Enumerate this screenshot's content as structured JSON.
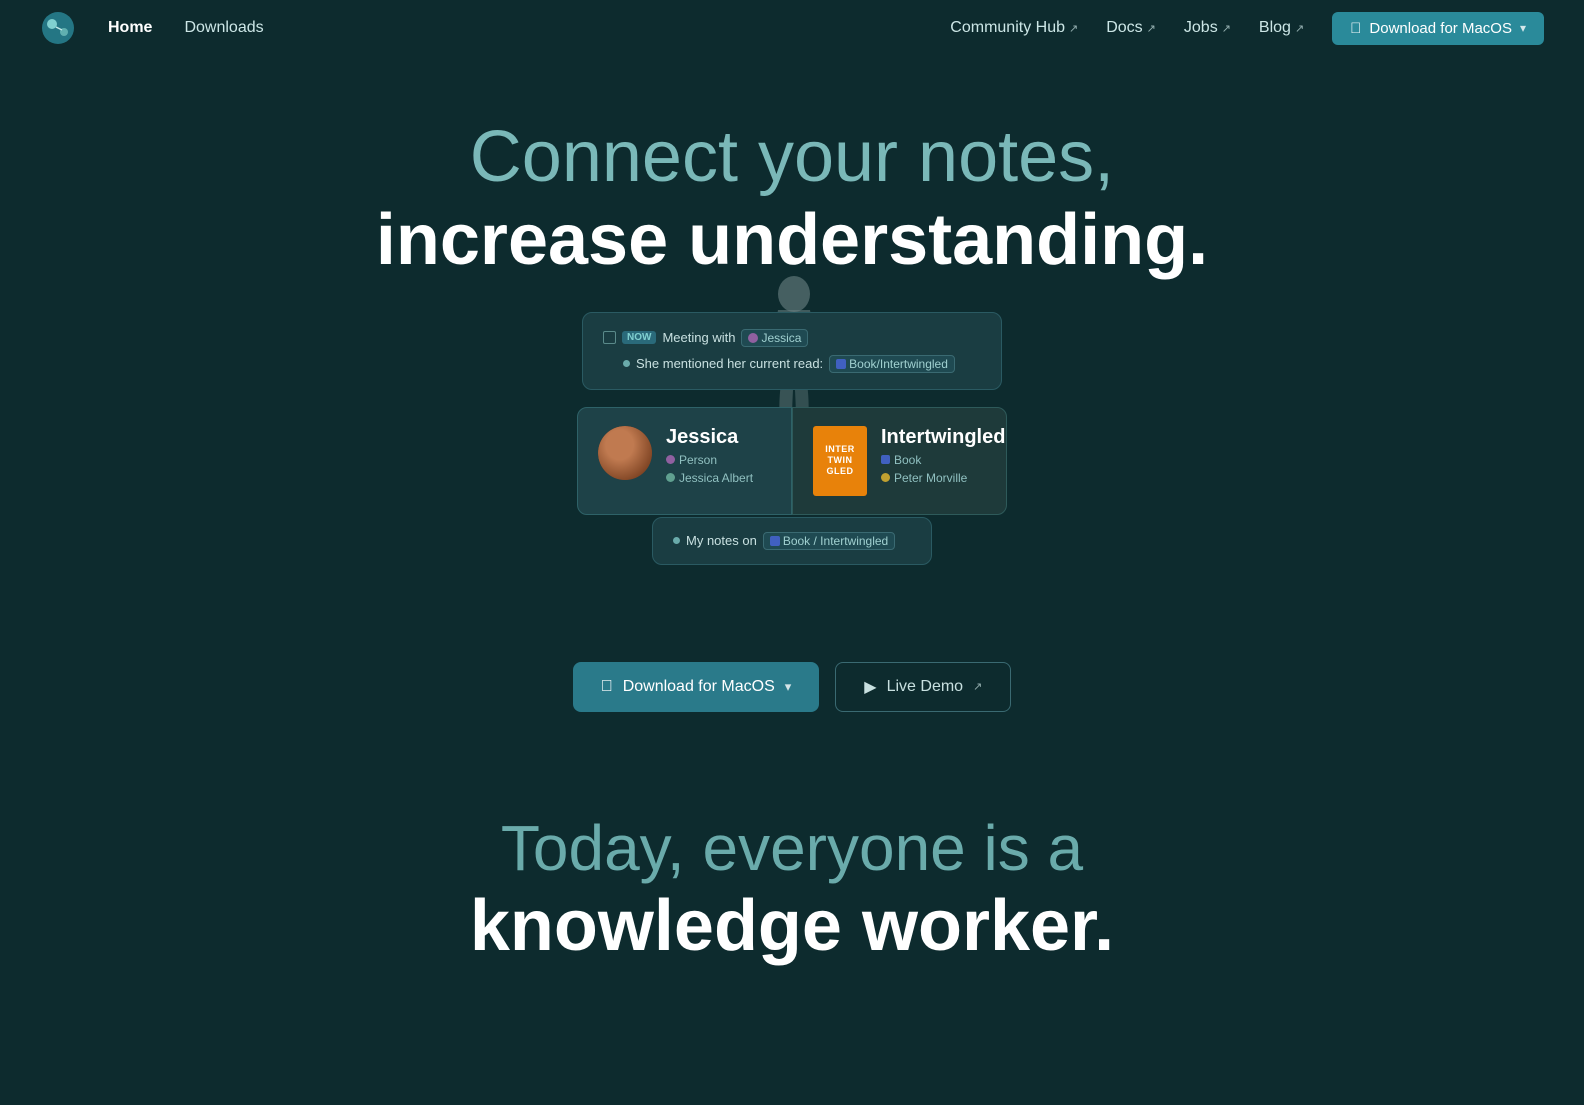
{
  "nav": {
    "logo_alt": "App Logo",
    "home_label": "Home",
    "downloads_label": "Downloads",
    "community_hub_label": "Community Hub",
    "docs_label": "Docs",
    "jobs_label": "Jobs",
    "blog_label": "Blog",
    "download_macos_label": "Download for MacOS"
  },
  "hero": {
    "title_light": "Connect your notes,",
    "title_bold": "increase understanding."
  },
  "note_card": {
    "now_badge": "NOW",
    "row1_text": "Meeting with",
    "row1_tag": "Jessica",
    "row2_text": "She mentioned her current read:",
    "row2_tag": "Book/Intertwingled"
  },
  "person_card": {
    "name": "Jessica",
    "tag1": "Person",
    "tag2": "Jessica Albert"
  },
  "book_card": {
    "title": "Intertwingled",
    "tag1": "Book",
    "tag2": "Peter Morville",
    "cover_line1": "INTER",
    "cover_line2": "TWIN",
    "cover_line3": "GLED"
  },
  "bottom_note": {
    "text": "My notes on",
    "tag": "Book / Intertwingled"
  },
  "cta": {
    "download_label": "Download for MacOS",
    "live_demo_label": "Live Demo"
  },
  "bottom": {
    "line1": "Today, everyone is a",
    "line2": "knowledge worker."
  }
}
